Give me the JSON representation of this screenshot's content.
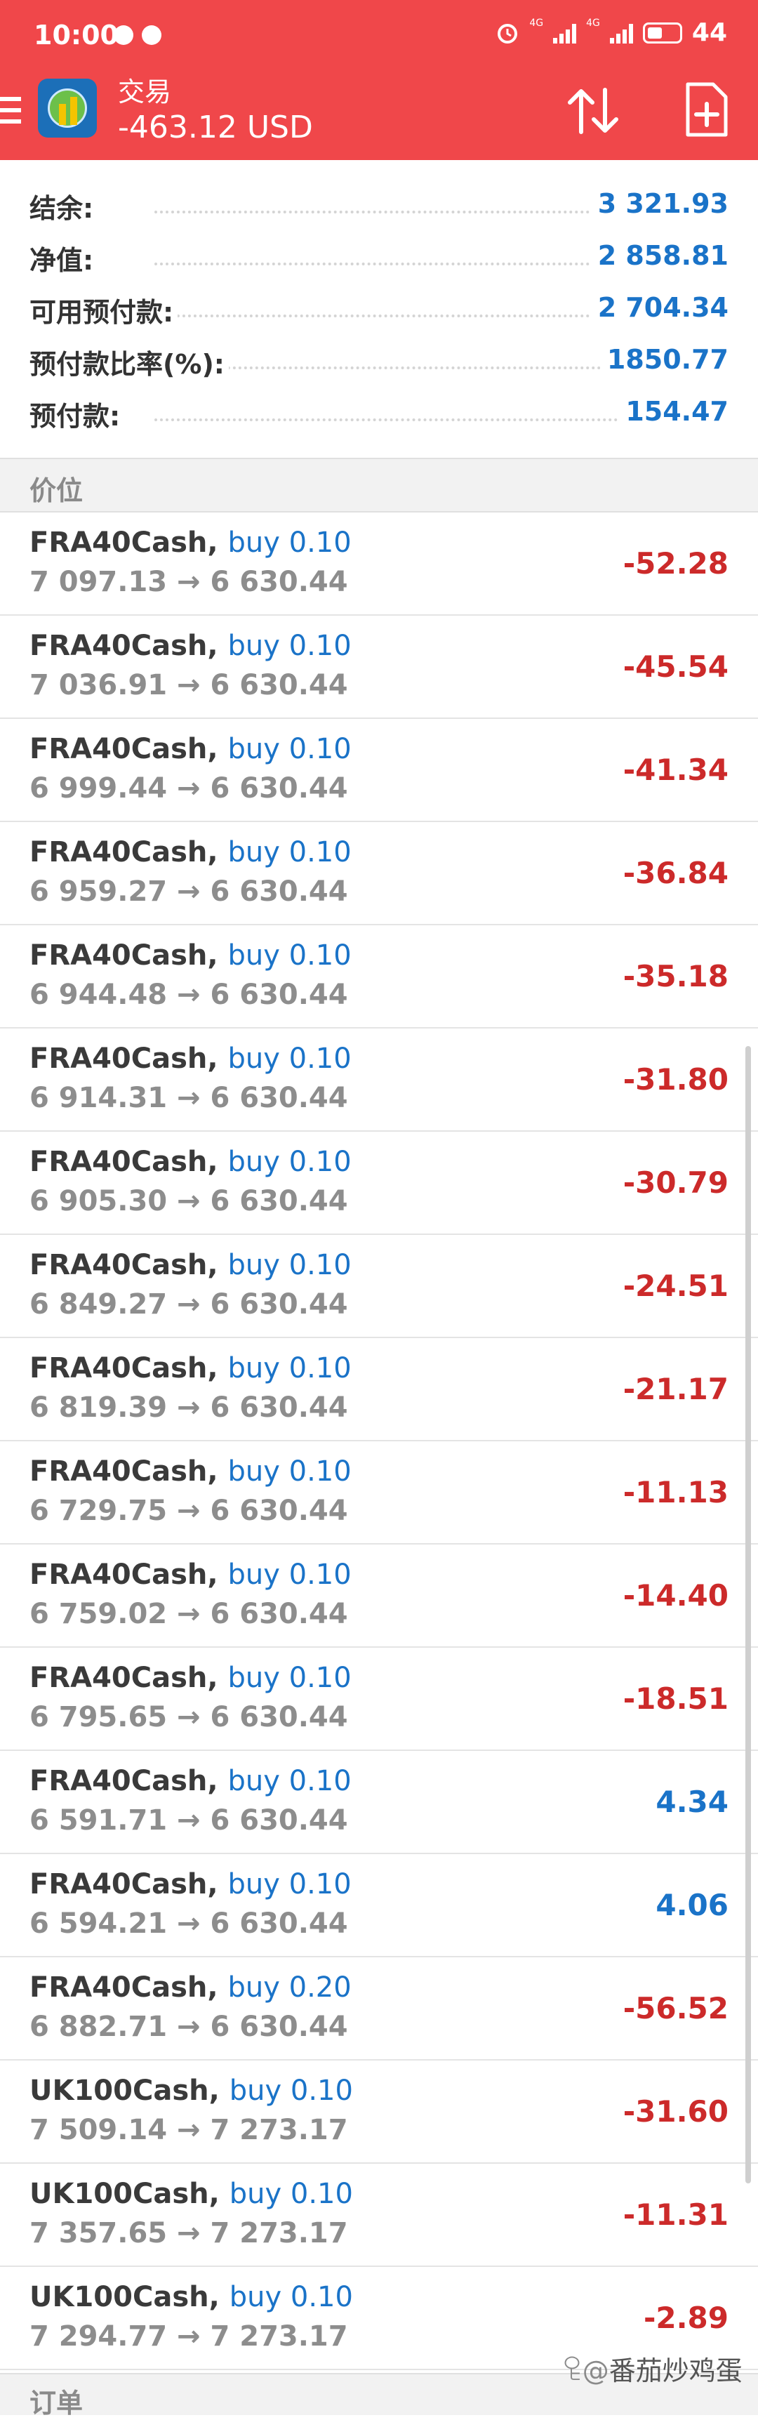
{
  "status_bar": {
    "time": "10:00",
    "net1": "4G",
    "net2": "4G",
    "battery": "44"
  },
  "app_bar": {
    "title": "交易",
    "balance_line": "-463.12 USD"
  },
  "summary": [
    {
      "label": "结余:",
      "value": "3 321.93"
    },
    {
      "label": "净值:",
      "value": "2 858.81"
    },
    {
      "label": "可用预付款:",
      "value": "2 704.34"
    },
    {
      "label": "预付款比率(%):",
      "value": "1850.77"
    },
    {
      "label": "预付款:",
      "value": "154.47"
    }
  ],
  "sections": {
    "positions": "价位",
    "orders": "订单"
  },
  "positions": [
    {
      "symbol": "FRA40Cash",
      "side": "buy 0.10",
      "prices": "7 097.13 → 6 630.44",
      "profit": "-52.28",
      "sign": "neg"
    },
    {
      "symbol": "FRA40Cash",
      "side": "buy 0.10",
      "prices": "7 036.91 → 6 630.44",
      "profit": "-45.54",
      "sign": "neg"
    },
    {
      "symbol": "FRA40Cash",
      "side": "buy 0.10",
      "prices": "6 999.44 → 6 630.44",
      "profit": "-41.34",
      "sign": "neg"
    },
    {
      "symbol": "FRA40Cash",
      "side": "buy 0.10",
      "prices": "6 959.27 → 6 630.44",
      "profit": "-36.84",
      "sign": "neg"
    },
    {
      "symbol": "FRA40Cash",
      "side": "buy 0.10",
      "prices": "6 944.48 → 6 630.44",
      "profit": "-35.18",
      "sign": "neg"
    },
    {
      "symbol": "FRA40Cash",
      "side": "buy 0.10",
      "prices": "6 914.31 → 6 630.44",
      "profit": "-31.80",
      "sign": "neg"
    },
    {
      "symbol": "FRA40Cash",
      "side": "buy 0.10",
      "prices": "6 905.30 → 6 630.44",
      "profit": "-30.79",
      "sign": "neg"
    },
    {
      "symbol": "FRA40Cash",
      "side": "buy 0.10",
      "prices": "6 849.27 → 6 630.44",
      "profit": "-24.51",
      "sign": "neg"
    },
    {
      "symbol": "FRA40Cash",
      "side": "buy 0.10",
      "prices": "6 819.39 → 6 630.44",
      "profit": "-21.17",
      "sign": "neg"
    },
    {
      "symbol": "FRA40Cash",
      "side": "buy 0.10",
      "prices": "6 729.75 → 6 630.44",
      "profit": "-11.13",
      "sign": "neg"
    },
    {
      "symbol": "FRA40Cash",
      "side": "buy 0.10",
      "prices": "6 759.02 → 6 630.44",
      "profit": "-14.40",
      "sign": "neg"
    },
    {
      "symbol": "FRA40Cash",
      "side": "buy 0.10",
      "prices": "6 795.65 → 6 630.44",
      "profit": "-18.51",
      "sign": "neg"
    },
    {
      "symbol": "FRA40Cash",
      "side": "buy 0.10",
      "prices": "6 591.71 → 6 630.44",
      "profit": "4.34",
      "sign": "pos"
    },
    {
      "symbol": "FRA40Cash",
      "side": "buy 0.10",
      "prices": "6 594.21 → 6 630.44",
      "profit": "4.06",
      "sign": "pos"
    },
    {
      "symbol": "FRA40Cash",
      "side": "buy 0.20",
      "prices": "6 882.71 → 6 630.44",
      "profit": "-56.52",
      "sign": "neg"
    },
    {
      "symbol": "UK100Cash",
      "side": "buy 0.10",
      "prices": "7 509.14 → 7 273.17",
      "profit": "-31.60",
      "sign": "neg"
    },
    {
      "symbol": "UK100Cash",
      "side": "buy 0.10",
      "prices": "7 357.65 → 7 273.17",
      "profit": "-11.31",
      "sign": "neg"
    },
    {
      "symbol": "UK100Cash",
      "side": "buy 0.10",
      "prices": "7 294.77 → 7 273.17",
      "profit": "-2.89",
      "sign": "neg"
    }
  ],
  "watermark": "番茄炒鸡蛋",
  "colors": {
    "header_red": "#f0474a",
    "value_blue": "#1a73c8",
    "loss_red": "#cc2a2a",
    "price_gray": "#8d8d8d"
  }
}
